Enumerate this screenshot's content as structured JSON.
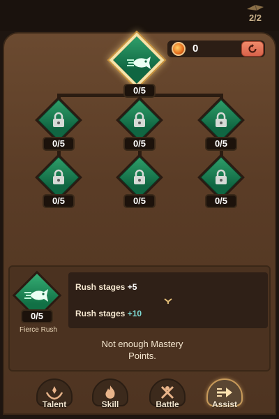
{
  "header": {
    "counter": "2/2"
  },
  "mastery": {
    "points": "0"
  },
  "tree": {
    "root": {
      "level": "0/5",
      "icon": "fish-rush-icon"
    },
    "nodes": [
      {
        "level": "0/5",
        "icon": "locked-rush-icon"
      },
      {
        "level": "0/5",
        "icon": "locked-rush-icon"
      },
      {
        "level": "0/5",
        "icon": "locked-rush-icon"
      },
      {
        "level": "0/5",
        "icon": "locked-rush-icon"
      },
      {
        "level": "0/5",
        "icon": "locked-rush-icon"
      },
      {
        "level": "0/5",
        "icon": "locked-rush-icon"
      }
    ]
  },
  "detail": {
    "level": "0/5",
    "name": "Fierce Rush",
    "current_label": "Rush stages ",
    "current_value": "+5",
    "next_label": "Rush stages ",
    "next_value": "+10",
    "warning": "Not enough Mastery Points."
  },
  "tabs": [
    {
      "label": "Talent",
      "icon": "talent-hands-icon"
    },
    {
      "label": "Skill",
      "icon": "flame-icon"
    },
    {
      "label": "Battle",
      "icon": "crossed-swords-icon"
    },
    {
      "label": "Assist",
      "icon": "arrow-assist-icon"
    }
  ],
  "colors": {
    "node_green": "#1a8a56",
    "panel_brown": "#5a3c26",
    "next_value": "#7fdcd6"
  }
}
